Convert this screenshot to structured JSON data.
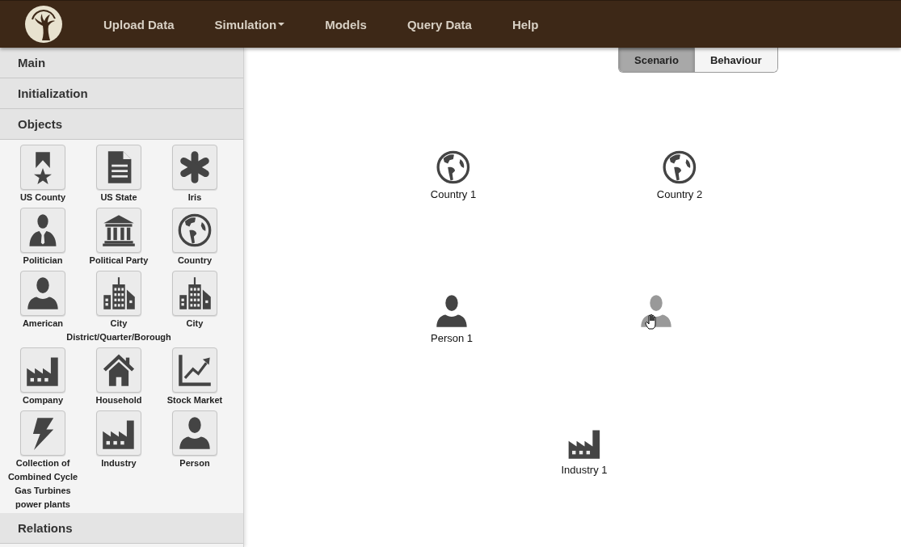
{
  "navbar": {
    "items": [
      {
        "label": "Upload Data",
        "dropdown": false
      },
      {
        "label": "Simulation",
        "dropdown": true
      },
      {
        "label": "Models",
        "dropdown": false
      },
      {
        "label": "Query Data",
        "dropdown": false
      },
      {
        "label": "Help",
        "dropdown": false
      }
    ]
  },
  "sidebar": {
    "sections": [
      {
        "title": "Main"
      },
      {
        "title": "Initialization"
      },
      {
        "title": "Objects",
        "items": [
          {
            "label": "US County",
            "kind": "ribbon"
          },
          {
            "label": "US State",
            "kind": "document"
          },
          {
            "label": "Iris",
            "kind": "asterisk"
          },
          {
            "label": "Politician",
            "kind": "politician"
          },
          {
            "label": "Political Party",
            "kind": "bank"
          },
          {
            "label": "Country",
            "kind": "globe"
          },
          {
            "label": "American",
            "kind": "person"
          },
          {
            "label": "City District/Quarter/Borough",
            "kind": "city"
          },
          {
            "label": "City",
            "kind": "city"
          },
          {
            "label": "Company",
            "kind": "factory"
          },
          {
            "label": "Household",
            "kind": "house"
          },
          {
            "label": "Stock Market",
            "kind": "chart"
          },
          {
            "label": "Collection of Combined Cycle Gas Turbines power plants",
            "kind": "bolt"
          },
          {
            "label": "Industry",
            "kind": "factory"
          },
          {
            "label": "Person",
            "kind": "person"
          }
        ]
      },
      {
        "title": "Relations"
      }
    ]
  },
  "tabs": [
    {
      "label": "Scenario",
      "selected": true
    },
    {
      "label": "Behaviour",
      "selected": false
    }
  ],
  "canvas": {
    "nodes": [
      {
        "label": "Country 1",
        "kind": "globe",
        "dragging": false
      },
      {
        "label": "Country 2",
        "kind": "globe",
        "dragging": false
      },
      {
        "label": "Person 1",
        "kind": "person",
        "dragging": false
      },
      {
        "kind": "person",
        "dragging": true
      },
      {
        "label": "Industry 1",
        "kind": "factory",
        "dragging": false
      }
    ]
  }
}
